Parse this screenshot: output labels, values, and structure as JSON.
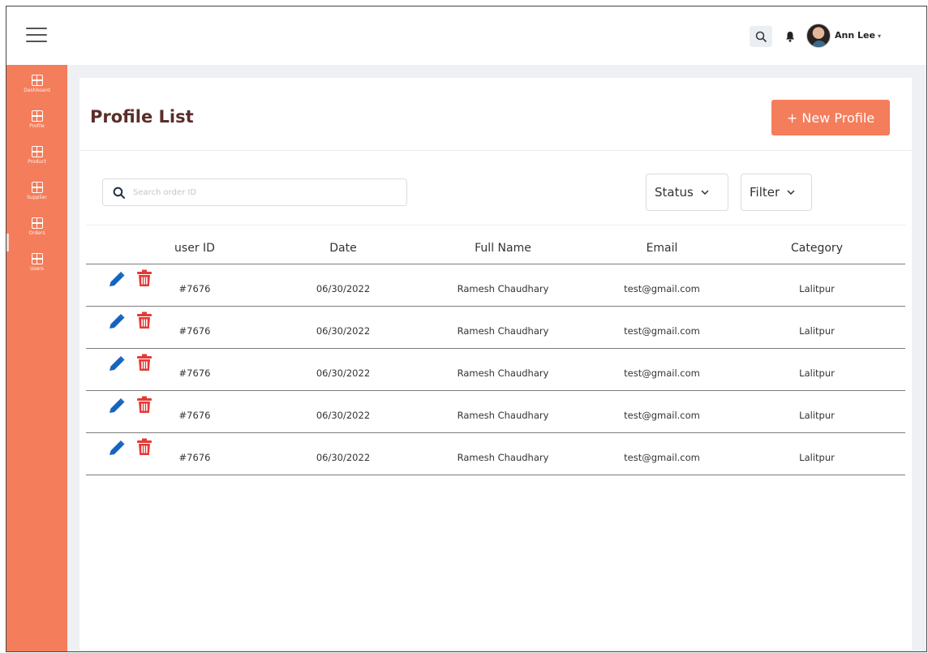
{
  "header": {
    "menu_icon": "hamburger-menu-icon",
    "search_icon": "search-icon",
    "notification_icon": "bell-icon",
    "user_name": "Ann Lee",
    "user_caret": "▾"
  },
  "sidebar": {
    "items": [
      {
        "label": "Dashboard",
        "icon": "grid-icon"
      },
      {
        "label": "Profile",
        "icon": "grid-icon"
      },
      {
        "label": "Product",
        "icon": "grid-icon"
      },
      {
        "label": "Supplier",
        "icon": "grid-icon"
      },
      {
        "label": "Orders",
        "icon": "grid-icon"
      },
      {
        "label": "Users",
        "icon": "grid-icon"
      }
    ],
    "active_item": "Orders"
  },
  "page": {
    "title": "Profile List",
    "new_button_label": "+ New Profile"
  },
  "filters": {
    "search_placeholder": "Search order ID",
    "status_label": "Status",
    "filter_label": "Filter",
    "chevron": "⌄"
  },
  "table": {
    "columns": [
      "user ID",
      "Date",
      "Full Name",
      "Email",
      "Category"
    ],
    "rows": [
      {
        "user_id": "#7676",
        "date": "06/30/2022",
        "full_name": "Ramesh Chaudhary",
        "email": "test@gmail.com",
        "category": "Lalitpur"
      },
      {
        "user_id": "#7676",
        "date": "06/30/2022",
        "full_name": "Ramesh Chaudhary",
        "email": "test@gmail.com",
        "category": "Lalitpur"
      },
      {
        "user_id": "#7676",
        "date": "06/30/2022",
        "full_name": "Ramesh Chaudhary",
        "email": "test@gmail.com",
        "category": "Lalitpur"
      },
      {
        "user_id": "#7676",
        "date": "06/30/2022",
        "full_name": "Ramesh Chaudhary",
        "email": "test@gmail.com",
        "category": "Lalitpur"
      },
      {
        "user_id": "#7676",
        "date": "06/30/2022",
        "full_name": "Ramesh Chaudhary",
        "email": "test@gmail.com",
        "category": "Lalitpur"
      }
    ],
    "row_actions": [
      "pencil-icon",
      "trash-icon"
    ]
  },
  "colors": {
    "accent": "#f47d5b",
    "title": "#5a2d2a",
    "edit_icon": "#1565c0",
    "delete_icon": "#e53935",
    "background": "#eef0f3"
  }
}
